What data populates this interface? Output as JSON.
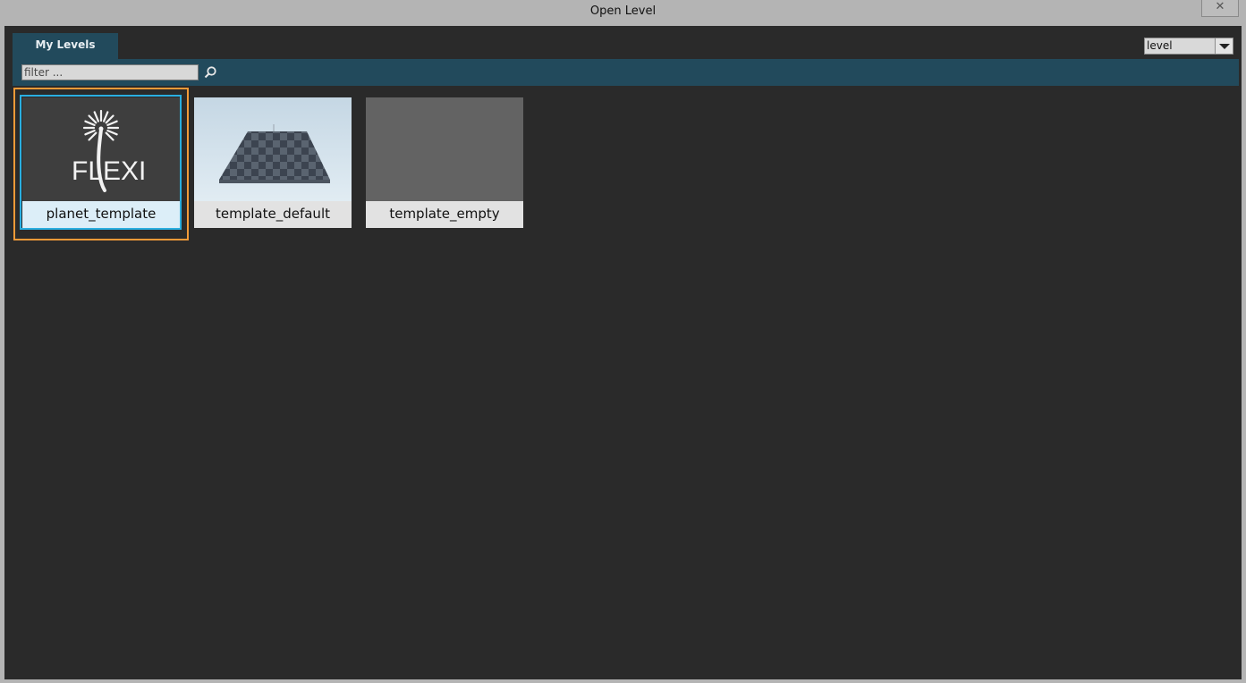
{
  "window": {
    "title": "Open Level",
    "close_symbol": "✕"
  },
  "tabs": [
    {
      "label": "My Levels"
    }
  ],
  "type_select": {
    "value": "level"
  },
  "filter": {
    "placeholder": "filter ..."
  },
  "levels": [
    {
      "name": "planet_template",
      "thumbnail": "flexi-logo",
      "selected": true
    },
    {
      "name": "template_default",
      "thumbnail": "checkerboard-plane"
    },
    {
      "name": "template_empty",
      "thumbnail": "empty-gray"
    }
  ],
  "logo_text": "FLEXI",
  "colors": {
    "panel": "#2a2a2a",
    "accent_bar": "#224a5c",
    "selection_outer": "#f29a38",
    "selection_inner": "#2aaee0"
  }
}
